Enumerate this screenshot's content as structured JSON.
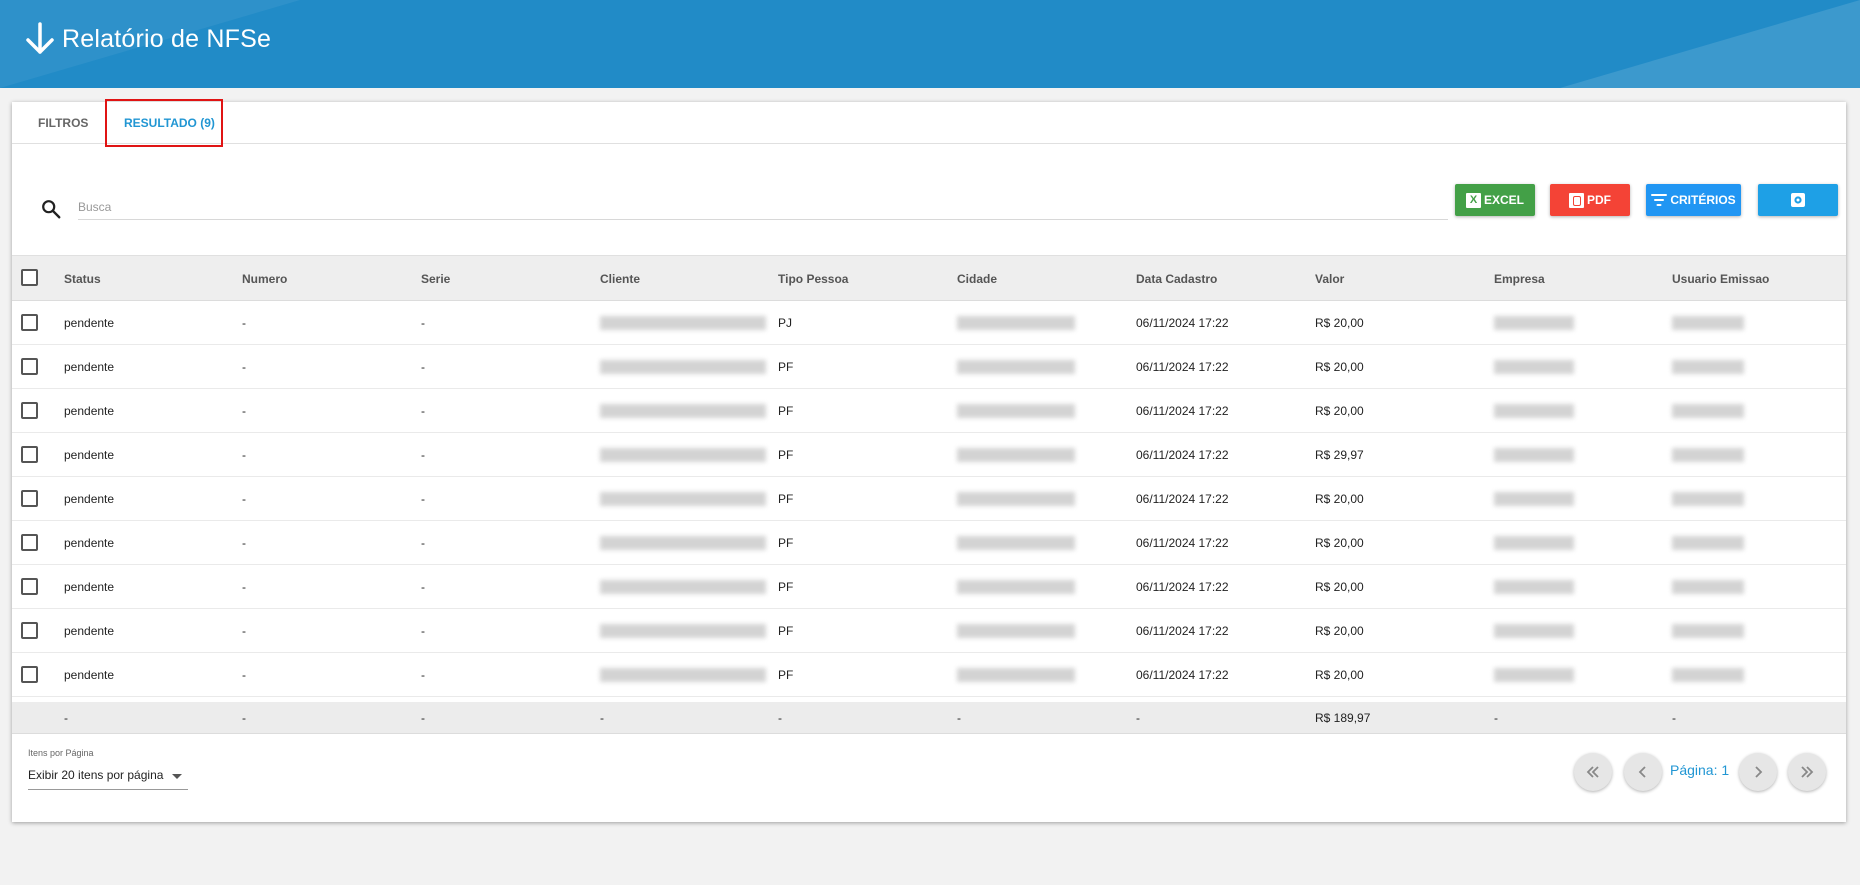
{
  "header": {
    "title": "Relatório de NFSe"
  },
  "tabs": {
    "filtros": "FILTROS",
    "resultado": "RESULTADO (9)"
  },
  "search": {
    "placeholder": "Busca"
  },
  "toolbar": {
    "excel": "EXCEL",
    "pdf": "PDF",
    "criterios": "CRITÉRIOS"
  },
  "columns": [
    "Status",
    "Numero",
    "Serie",
    "Cliente",
    "Tipo Pessoa",
    "Cidade",
    "Data Cadastro",
    "Valor",
    "Empresa",
    "Usuario Emissao"
  ],
  "rows": [
    {
      "status": "pendente",
      "numero": "-",
      "serie": "-",
      "tipo": "PJ",
      "data": "06/11/2024 17:22",
      "valor": "R$ 20,00"
    },
    {
      "status": "pendente",
      "numero": "-",
      "serie": "-",
      "tipo": "PF",
      "data": "06/11/2024 17:22",
      "valor": "R$ 20,00"
    },
    {
      "status": "pendente",
      "numero": "-",
      "serie": "-",
      "tipo": "PF",
      "data": "06/11/2024 17:22",
      "valor": "R$ 20,00"
    },
    {
      "status": "pendente",
      "numero": "-",
      "serie": "-",
      "tipo": "PF",
      "data": "06/11/2024 17:22",
      "valor": "R$ 29,97"
    },
    {
      "status": "pendente",
      "numero": "-",
      "serie": "-",
      "tipo": "PF",
      "data": "06/11/2024 17:22",
      "valor": "R$ 20,00"
    },
    {
      "status": "pendente",
      "numero": "-",
      "serie": "-",
      "tipo": "PF",
      "data": "06/11/2024 17:22",
      "valor": "R$ 20,00"
    },
    {
      "status": "pendente",
      "numero": "-",
      "serie": "-",
      "tipo": "PF",
      "data": "06/11/2024 17:22",
      "valor": "R$ 20,00"
    },
    {
      "status": "pendente",
      "numero": "-",
      "serie": "-",
      "tipo": "PF",
      "data": "06/11/2024 17:22",
      "valor": "R$ 20,00"
    },
    {
      "status": "pendente",
      "numero": "-",
      "serie": "-",
      "tipo": "PF",
      "data": "06/11/2024 17:22",
      "valor": "R$ 20,00"
    }
  ],
  "footer": {
    "status": "-",
    "numero": "-",
    "serie": "-",
    "cliente": "-",
    "tipo": "-",
    "cidade": "-",
    "data": "-",
    "valor": "R$ 189,97",
    "empresa": "-",
    "usuario": "-"
  },
  "pagination": {
    "per_page_label": "Itens por Página",
    "per_page_value": "Exibir 20 itens por página",
    "page_label": "Página: 1"
  },
  "colors": {
    "header": "#218bc7",
    "accent": "#2196d3",
    "excel": "#43a047",
    "pdf": "#f44336",
    "criterios": "#2196f3"
  }
}
